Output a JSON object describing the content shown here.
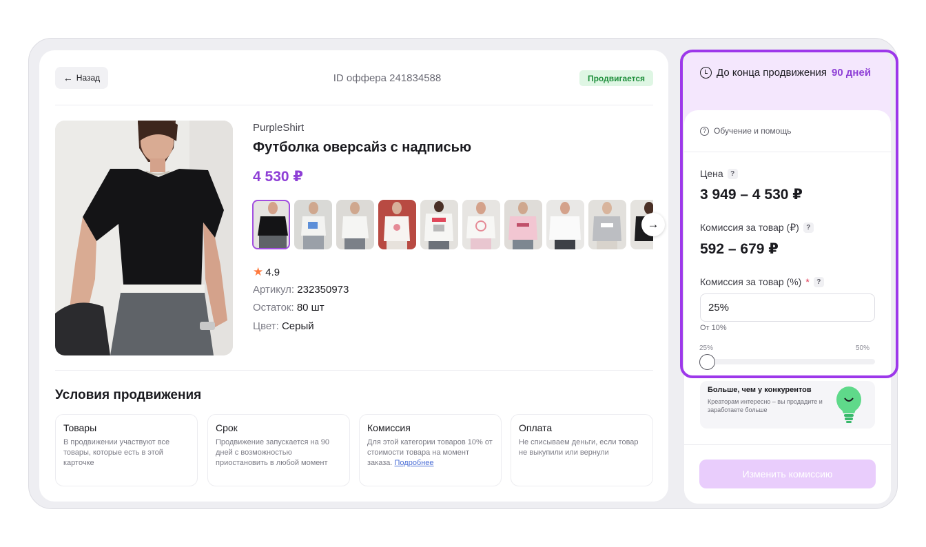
{
  "header": {
    "back_label": "Назад",
    "offer_id": "ID оффера 241834588",
    "status": "Продвигается"
  },
  "product": {
    "brand": "PurpleShirt",
    "title": "Футболка оверсайз с надписью",
    "price": "4 530 ₽",
    "rating": "4.9",
    "article_label": "Артикул:",
    "article_value": "232350973",
    "stock_label": "Остаток:",
    "stock_value": "80 шт",
    "color_label": "Цвет:",
    "color_value": "Серый"
  },
  "conditions": {
    "title": "Условия продвижения",
    "cards": [
      {
        "title": "Товары",
        "text": "В продвижении участвуют все товары, которые есть в этой карточке"
      },
      {
        "title": "Срок",
        "text": "Продвижение запускается на 90 дней с возможностью приостановить в любой момент"
      },
      {
        "title": "Комиссия",
        "text": "Для этой категории товаров 10% от стоимости товара на момент заказа.",
        "link": "Подробнее"
      },
      {
        "title": "Оплата",
        "text": "Не списываем деньги, если товар не выкупили или вернули"
      }
    ]
  },
  "side": {
    "promo_prefix": "До конца продвижения",
    "promo_days": "90 дней",
    "help_label": "Обучение и помощь",
    "price_label": "Цена",
    "price_value": "3 949 – 4 530 ₽",
    "commission_rub_label": "Комиссия за товар (₽)",
    "commission_rub_value": "592 – 679 ₽",
    "commission_pct_label": "Комиссия за товар (%)",
    "commission_pct_value": "25%",
    "commission_hint": "От 10%",
    "slider_min": "25%",
    "slider_max": "50%",
    "slider_value_fraction": 0,
    "tip_title": "Больше, чем у конкурентов",
    "tip_text": "Креаторам интересно – вы продадите и заработаете больше",
    "button_label": "Изменить комиссию"
  },
  "colors": {
    "accent": "#8e3fd6",
    "highlight_border": "#9d38ea",
    "status_bg": "#dff6e4",
    "status_text": "#1f8f3c",
    "button_bg": "#e9cdfc"
  }
}
